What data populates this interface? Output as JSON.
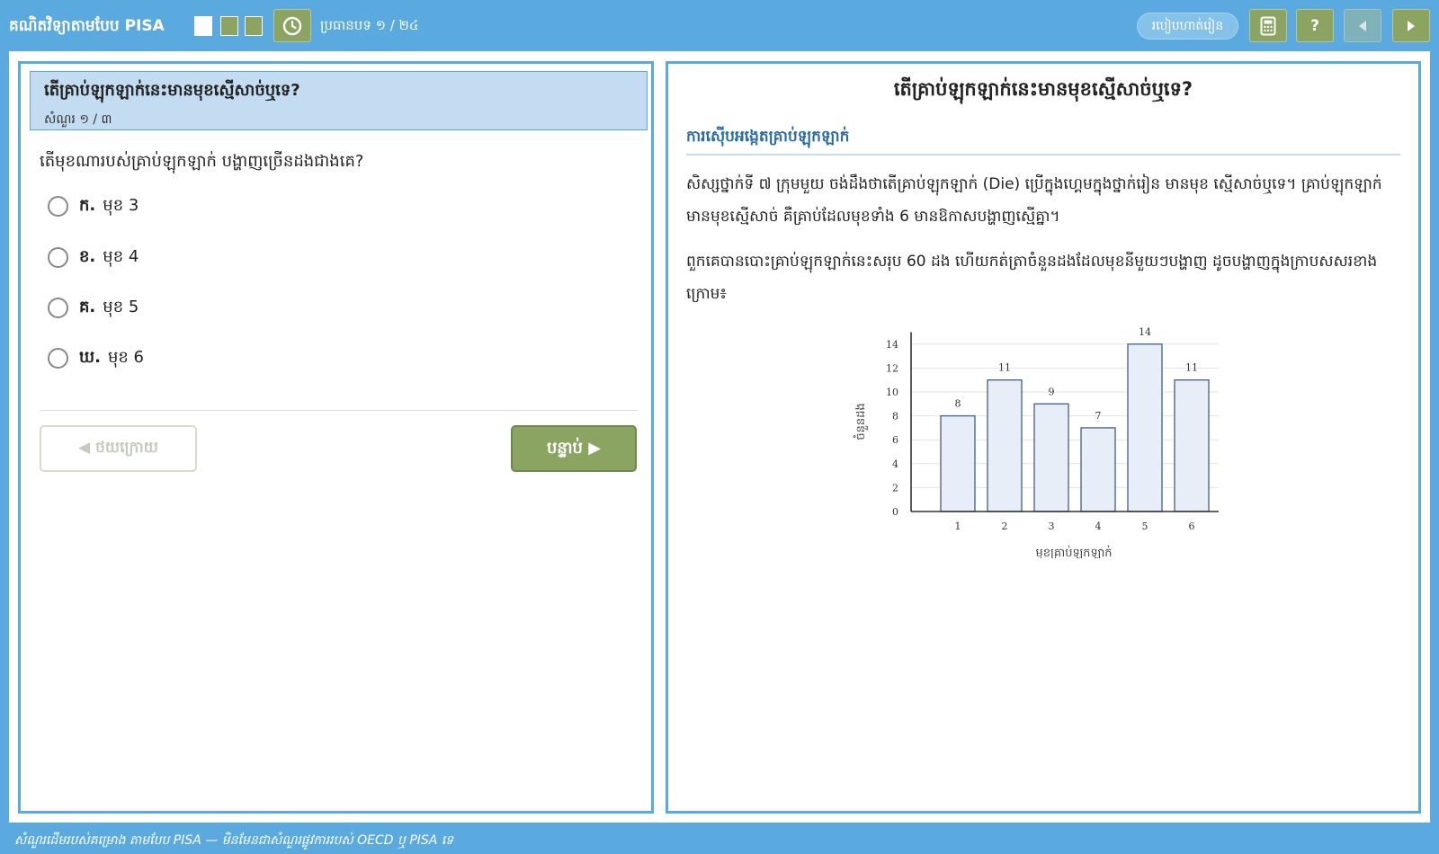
{
  "app": {
    "title": "គណិតវិទ្យាតាមបែប PISA",
    "section_counter": "ប្រធានបទ ១ / ២៤",
    "howto_label": "របៀបហាត់រៀន",
    "help_label": "?"
  },
  "question_panel": {
    "title": "តើគ្រាប់ឡុកឡាក់នេះមានមុខស្មើសាច់ឬទេ?",
    "counter": "សំណួរ ១ / ៣",
    "prompt": "តើមុខណារបស់គ្រាប់ឡុកឡាក់ បង្ហាញច្រើនដងជាងគេ?",
    "options": [
      {
        "letter": "ក.",
        "text": "មុខ 3"
      },
      {
        "letter": "ខ.",
        "text": "មុខ 4"
      },
      {
        "letter": "គ.",
        "text": "មុខ 5"
      },
      {
        "letter": "ឃ.",
        "text": "មុខ 6"
      }
    ],
    "back_label": "◀ ថយក្រោយ",
    "next_label": "បន្ទាប់ ▶"
  },
  "stimulus": {
    "title": "តើគ្រាប់ឡុកឡាក់នេះមានមុខស្មើសាច់ឬទេ?",
    "subtitle": "ការស៊ើបអង្កេតគ្រាប់ឡុកឡាក់",
    "paragraph1": "សិស្សថ្នាក់ទី ៧ ក្រុមមួយ ចង់ដឹងថាតើគ្រាប់ឡុកឡាក់ (Die) ប្រើក្នុងហ្គេមក្នុងថ្នាក់រៀន មានមុខ ស្មើសាច់ឬទេ។ គ្រាប់ឡុកឡាក់មានមុខស្មើសាច់ គឺគ្រាប់ដែលមុខទាំង 6 មានឱកាសបង្ហាញស្មើគ្នា។",
    "paragraph2": "ពួកគេបានបោះគ្រាប់ឡុកឡាក់នេះសរុប 60 ដង ហើយកត់ត្រាចំនួនដងដែលមុខនីមួយៗបង្ហាញ ដូចបង្ហាញក្នុងក្រាបសសរខាងក្រោម៖"
  },
  "chart_data": {
    "type": "bar",
    "categories": [
      "1",
      "2",
      "3",
      "4",
      "5",
      "6"
    ],
    "values": [
      8,
      11,
      9,
      7,
      14,
      11
    ],
    "data_labels": [
      "8",
      "11",
      "9",
      "7",
      "14",
      "11"
    ],
    "title": "",
    "xlabel": "មុខគ្រាប់ឡុកឡាក់",
    "ylabel": "ចំនួនដង",
    "ylim": [
      0,
      15
    ],
    "yticks": [
      "0",
      "2",
      "4",
      "6",
      "8",
      "10",
      "12",
      "14"
    ],
    "grid": true,
    "bar_fill": "#e8eef7",
    "bar_stroke": "#4e6a90"
  },
  "footer": {
    "text": "សំណួរដើមរបស់គម្រោង តាមបែប PISA — មិនមែនជាសំណួរផ្លូវការរបស់ OECD ឬ PISA ទេ"
  },
  "colors": {
    "frame": "#5aaadf",
    "accent_green": "#8ba462",
    "header_tint": "#c4dcf1"
  }
}
